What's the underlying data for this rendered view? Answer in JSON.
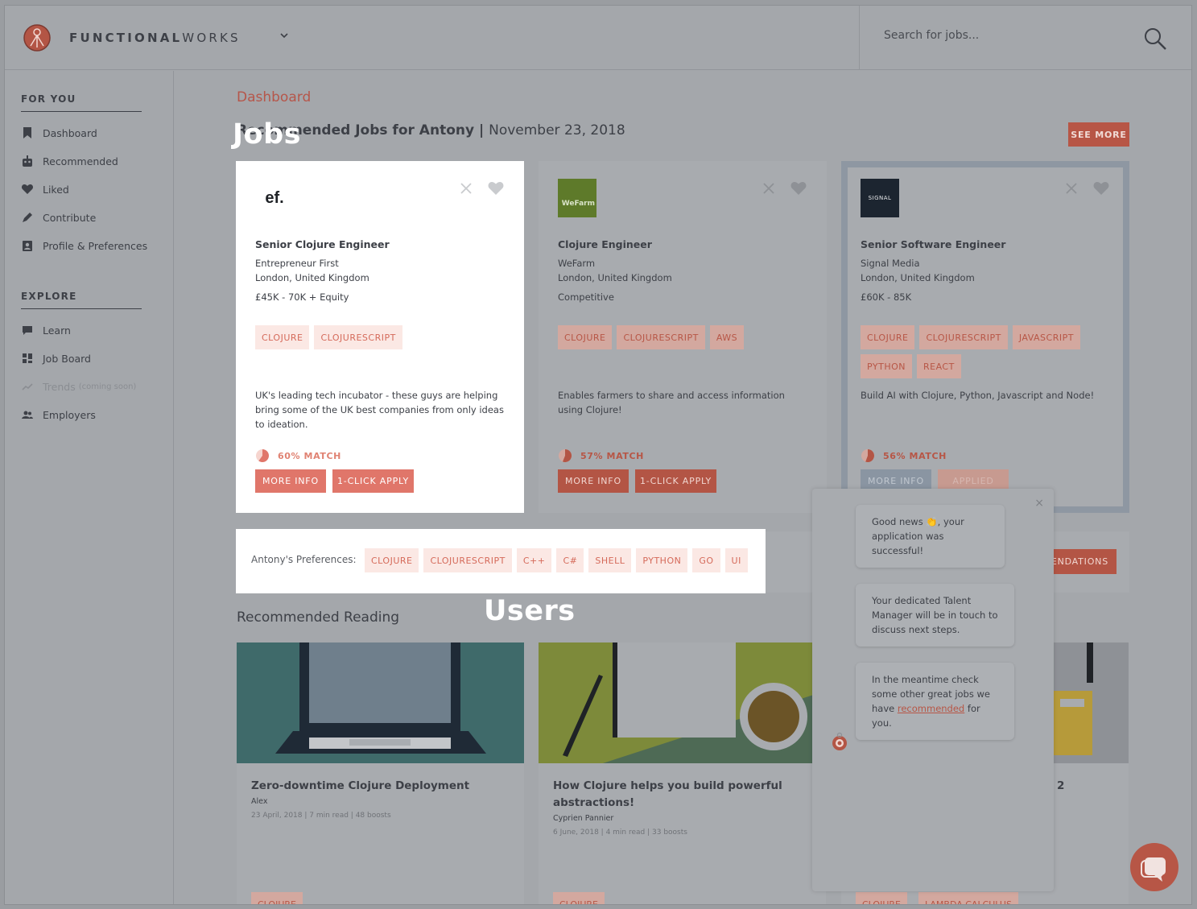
{
  "header": {
    "brand_bold": "FUNCTIONAL",
    "brand_light": "WORKS",
    "search_placeholder": "Search for jobs..."
  },
  "sidebar": {
    "for_you_heading": "FOR YOU",
    "for_you_items": [
      {
        "label": "Dashboard",
        "icon": "bookmark-icon"
      },
      {
        "label": "Recommended",
        "icon": "robot-icon"
      },
      {
        "label": "Liked",
        "icon": "heart-icon"
      },
      {
        "label": "Contribute",
        "icon": "pen-icon"
      },
      {
        "label": "Profile & Preferences",
        "icon": "profile-icon"
      }
    ],
    "explore_heading": "EXPLORE",
    "explore_items": [
      {
        "label": "Learn",
        "icon": "chat-icon"
      },
      {
        "label": "Job Board",
        "icon": "grid-icon"
      },
      {
        "label": "Trends",
        "suffix": "(coming soon)",
        "icon": "trend-icon"
      },
      {
        "label": "Employers",
        "icon": "people-icon"
      }
    ]
  },
  "main": {
    "page_label": "Dashboard",
    "rec_title_prefix": "Recommended Jobs for Antony |",
    "rec_date": "November 23, 2018",
    "see_more": "SEE MORE",
    "tour_jobs": "Jobs",
    "tour_users": "Users"
  },
  "jobs": [
    {
      "logo_text": "ef.",
      "title": "Senior Clojure Engineer",
      "company": "Entrepreneur First",
      "location": "London, United Kingdom",
      "salary": "£45K - 70K + Equity",
      "tags": [
        "CLOJURE",
        "CLOJURESCRIPT"
      ],
      "description": "UK's leading tech incubator - these guys are helping bring some of the UK best companies from only ideas to ideation.",
      "match": "60% MATCH",
      "match_value": 0.6,
      "more_info": "MORE INFO",
      "apply": "1-CLICK APPLY"
    },
    {
      "logo_text": "WeFarm",
      "title": "Clojure Engineer",
      "company": "WeFarm",
      "location": "London, United Kingdom",
      "salary": "Competitive",
      "tags": [
        "CLOJURE",
        "CLOJURESCRIPT",
        "AWS"
      ],
      "description": "Enables farmers to share and access information using Clojure!",
      "match": "57% MATCH",
      "match_value": 0.57,
      "more_info": "MORE INFO",
      "apply": "1-CLICK APPLY"
    },
    {
      "logo_text": "SIGNAL",
      "title": "Senior Software Engineer",
      "company": "Signal Media",
      "location": "London, United Kingdom",
      "salary": "£60K - 85K",
      "tags": [
        "CLOJURE",
        "CLOJURESCRIPT",
        "JAVASCRIPT",
        "PYTHON",
        "REACT"
      ],
      "description": "Build AI with Clojure, Python, Javascript and Node!",
      "match": "56% MATCH",
      "match_value": 0.56,
      "more_info": "MORE INFO",
      "apply": "APPLIED"
    }
  ],
  "preferences": {
    "label": "Antony's Preferences:",
    "tags": [
      "CLOJURE",
      "CLOJURESCRIPT",
      "C++",
      "C#",
      "SHELL",
      "PYTHON",
      "GO",
      "UI"
    ],
    "button_partial": "ENDATIONS"
  },
  "reading": {
    "title": "Recommended Reading",
    "articles": [
      {
        "title": "Zero-downtime Clojure Deployment",
        "author": "Alex",
        "meta": "23 April, 2018 | 7 min read | 48 boosts",
        "tag": "CLOJURE"
      },
      {
        "title": "How Clojure helps you build powerful abstractions!",
        "author": "Cyprien Pannier",
        "meta": "6 June, 2018 | 4 min read | 33 boosts",
        "tag": "CLOJURE"
      },
      {
        "title_partial": "2",
        "tags": [
          "CLOJURE",
          "LAMBDA CALCULUS"
        ]
      }
    ]
  },
  "chat": {
    "close": "×",
    "msg1_a": "Good news 👏, your",
    "msg1_b": "application was",
    "msg1_c": "successful!",
    "msg2": "Your dedicated Talent Manager will be in touch to discuss next steps.",
    "msg3_prefix": "In the meantime check some other great jobs we have",
    "msg3_link": "recommended",
    "msg3_suffix": "for you."
  },
  "colors": {
    "accent": "#e0766a",
    "accent_dim": "#b35545",
    "overlay_bg": "#a4a7ab"
  }
}
